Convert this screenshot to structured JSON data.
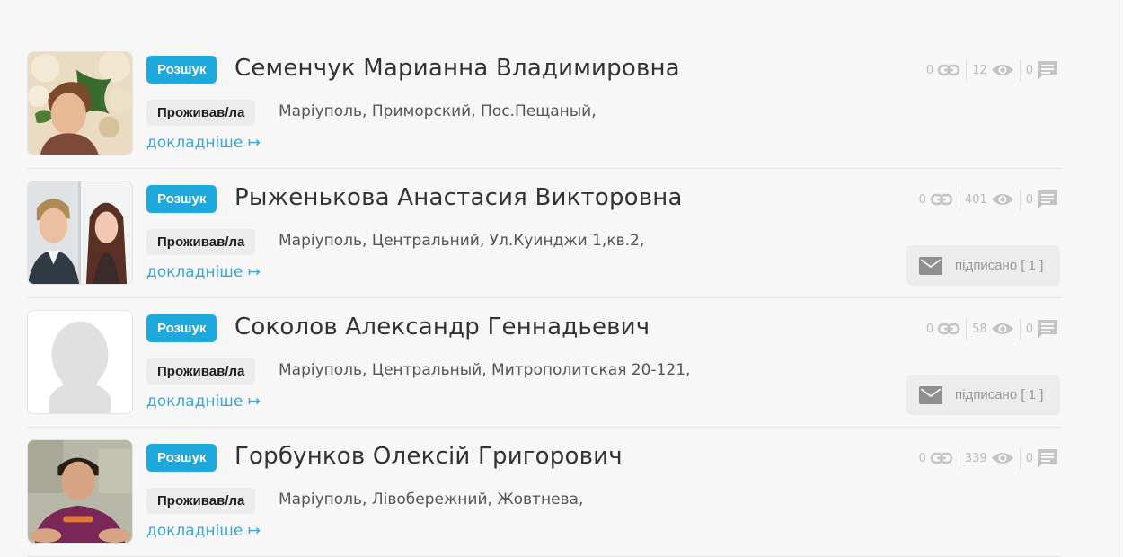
{
  "items": [
    {
      "badge": "Розшук",
      "name": "Семенчук Марианна Владимировна",
      "lived_label": "Проживав/ла",
      "address": "Маріуполь, Приморский, Пос.Пещаный,",
      "more_link": "докладніше ↦",
      "links": "0",
      "views": "12",
      "comments": "0",
      "subscribed": ""
    },
    {
      "badge": "Розшук",
      "name": "Рыженькова Анастасия Викторовна",
      "lived_label": "Проживав/ла",
      "address": "Маріуполь, Центральний, Ул.Куинджи 1,кв.2,",
      "more_link": "докладніше ↦",
      "links": "0",
      "views": "401",
      "comments": "0",
      "subscribed": "підписано [ 1 ]"
    },
    {
      "badge": "Розшук",
      "name": "Соколов Александр Геннадьевич",
      "lived_label": "Проживав/ла",
      "address": "Маріуполь, Центральный, Митрополитская 20-121,",
      "more_link": "докладніше ↦",
      "links": "0",
      "views": "58",
      "comments": "0",
      "subscribed": "підписано [ 1 ]"
    },
    {
      "badge": "Розшук",
      "name": "Горбунков Олексій Григорович",
      "lived_label": "Проживав/ла",
      "address": "Маріуполь, Лівобережний, Жовтнева,",
      "more_link": "докладніше ↦",
      "links": "0",
      "views": "339",
      "comments": "0",
      "subscribed": ""
    }
  ],
  "icons": {
    "link": "link-icon",
    "views": "eye-icon",
    "comments": "comment-icon",
    "subscribe": "envelope-icon"
  },
  "colors": {
    "badge": "#1ea9dd",
    "link": "#3aa6d6",
    "tag_bg": "#ececec",
    "icon": "#c4c4c4"
  }
}
